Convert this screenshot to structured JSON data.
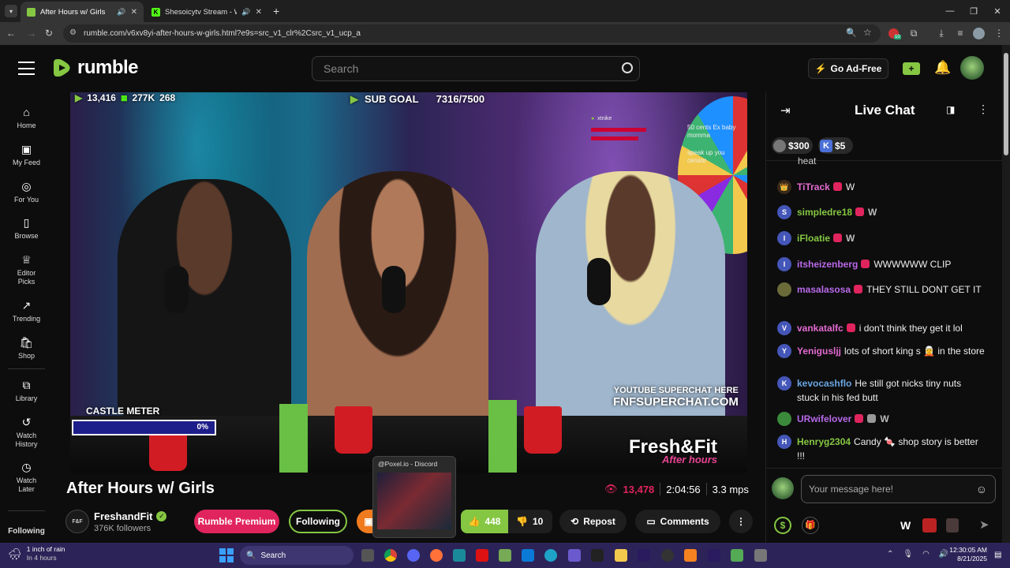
{
  "browser": {
    "tabs": [
      {
        "title": "After Hours w/ Girls",
        "active": true
      },
      {
        "title": "Shesoicytv Stream - Watch",
        "active": false
      }
    ],
    "url": "rumble.com/v6xv8yi-after-hours-w-girls.html?e9s=src_v1_clr%2Csrc_v1_ucp_a",
    "extension_badge": "10"
  },
  "header": {
    "logo_text": "rumble",
    "search_placeholder": "Search",
    "go_ad_free": "Go Ad-Free"
  },
  "sidebar": {
    "items": [
      {
        "label": "Home",
        "icon": "home-icon"
      },
      {
        "label": "My Feed",
        "icon": "feed-icon"
      },
      {
        "label": "For You",
        "icon": "target-icon"
      },
      {
        "label": "Browse",
        "icon": "browse-icon"
      },
      {
        "label": "Editor Picks",
        "icon": "award-icon"
      },
      {
        "label": "Trending",
        "icon": "trending-icon"
      },
      {
        "label": "Shop",
        "icon": "shop-icon"
      },
      {
        "label": "Library",
        "icon": "library-icon"
      },
      {
        "label": "Watch History",
        "icon": "history-icon"
      },
      {
        "label": "Watch Later",
        "icon": "clock-icon"
      }
    ],
    "following_label": "Following"
  },
  "video": {
    "overlay": {
      "viewers": "13,416",
      "followers": "277K",
      "count": "268",
      "sub_goal_label": "SUB GOAL",
      "sub_goal_value": "7316/7500",
      "castle_meter_label": "CASTLE METER",
      "castle_meter_pct": "0%",
      "castle_meter_fill": 0,
      "superchat_line1": "YOUTUBE SUPERCHAT HERE",
      "superchat_line2": "FNFSUPERCHAT.COM",
      "brand1": "Fresh&Fit",
      "brand2": "After hours",
      "chat_user": "xtnike",
      "chat_note1": "50 cents Ex baby momma",
      "chat_note2": "speak up you censor"
    }
  },
  "video_info": {
    "title": "After Hours w/ Girls",
    "viewers": "13,478",
    "duration": "2:04:56",
    "mps": "3.3 mps",
    "channel": "FreshandFit",
    "followers": "376K followers",
    "rumble_premium": "Rumble Premium",
    "following": "Following",
    "likes": "448",
    "dislikes": "10",
    "repost": "Repost",
    "comments": "Comments"
  },
  "discord_preview": {
    "title": "@Poxel.io - Discord"
  },
  "chat": {
    "title": "Live Chat",
    "rants": [
      {
        "amount": "$300"
      },
      {
        "amount": "$5"
      }
    ],
    "partial_top": "heat",
    "messages": [
      {
        "user": "TiTrack",
        "text": "W",
        "initial": "",
        "color": "#e36ad1"
      },
      {
        "user": "simpledre18",
        "text": "W",
        "initial": "S",
        "color": "#85c742"
      },
      {
        "user": "iFloatie",
        "text": "W",
        "initial": "I",
        "color": "#85c742"
      },
      {
        "user": "itsheizenberg",
        "text": "WWWWWW CLIP",
        "initial": "I",
        "color": "#b869e8"
      },
      {
        "user": "masalasosa",
        "text": "THEY STILL DONT GET IT",
        "initial": "",
        "color": "#b869e8"
      },
      {
        "user": "vankatalfc",
        "text": "i don't think they get it lol",
        "initial": "V",
        "color": "#e36ad1"
      },
      {
        "user": "Yenigusljj",
        "text": "lots of short king s 🧝 in the store",
        "initial": "Y",
        "color": "#e36ad1"
      },
      {
        "user": "kevocashflo",
        "text": "He still got nicks tiny nuts stuck in his fed butt",
        "initial": "K",
        "color": "#6aa6e3"
      },
      {
        "user": "URwifelover",
        "text": "W",
        "initial": "",
        "color": "#b869e8"
      },
      {
        "user": "Henryg2304",
        "text": "Candy 🍬 shop story is better !!!",
        "initial": "H",
        "color": "#85c742"
      }
    ],
    "input_placeholder": "Your message here!"
  },
  "taskbar": {
    "weather_line1": "1 inch of rain",
    "weather_line2": "In 4 hours",
    "search_label": "Search",
    "time": "12:30:05 AM",
    "date": "8/21/2025"
  }
}
